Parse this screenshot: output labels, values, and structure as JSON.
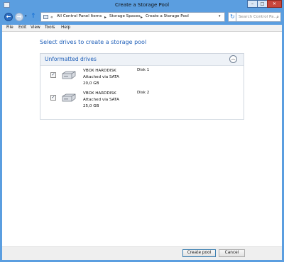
{
  "window": {
    "title": "Create a Storage Pool",
    "controls": {
      "minimize": "–",
      "maximize": "□",
      "close": "✕"
    }
  },
  "navigation": {
    "breadcrumb": [
      "All Control Panel Items",
      "Storage Spaces",
      "Create a Storage Pool"
    ],
    "search_placeholder": "Search Control Pa..."
  },
  "menu": [
    "File",
    "Edit",
    "View",
    "Tools",
    "Help"
  ],
  "main": {
    "heading": "Select drives to create a storage pool",
    "section": {
      "title": "Unformatted drives",
      "drives": [
        {
          "name": "VBOX HARDDISK",
          "connection": "Attached via SATA",
          "size": "20,0 GB",
          "disk": "Disk 1",
          "checked": true
        },
        {
          "name": "VBOX HARDDISK",
          "connection": "Attached via SATA",
          "size": "25,0 GB",
          "disk": "Disk 2",
          "checked": true
        }
      ]
    }
  },
  "footer": {
    "create_label": "Create pool",
    "cancel_label": "Cancel"
  },
  "icons": {
    "back": "back-arrow-icon",
    "forward": "forward-arrow-icon",
    "up": "up-arrow-icon",
    "refresh": "refresh-icon",
    "search": "search-icon",
    "collapse": "collapse-chevron-icon",
    "drive": "hard-drive-icon"
  }
}
